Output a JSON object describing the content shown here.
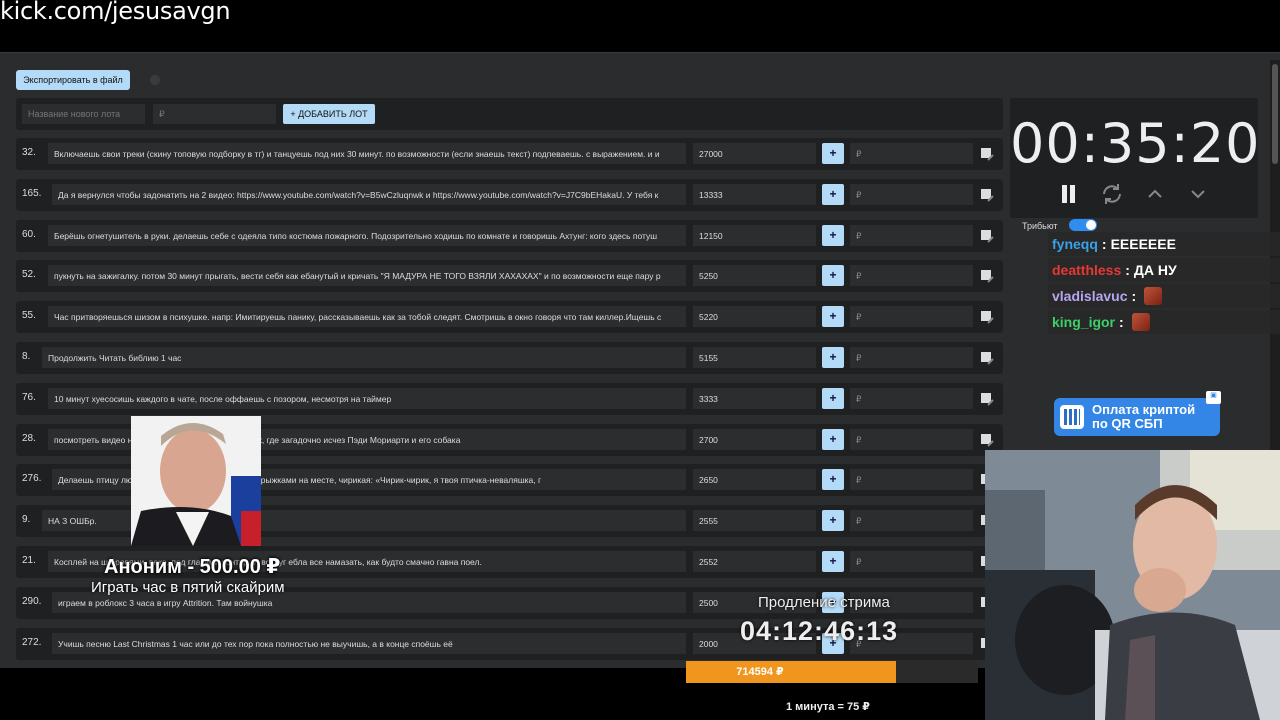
{
  "page": {
    "url": "kick.com/jesusavgn"
  },
  "toolbar": {
    "export_label": "Экспортировать в файл"
  },
  "add_lot": {
    "name_placeholder": "Название нового лота",
    "price_placeholder": "₽",
    "button_label": "+ ДОБАВИТЬ ЛОТ"
  },
  "lots": [
    {
      "num": "32.",
      "title": "Включаешь свои треки (скину топовую подборку в тг) и танцуешь под них 30 минут. по возможности (если знаешь текст) подпеваешь. с выражением. и и",
      "amount": "27000",
      "add_placeholder": "₽"
    },
    {
      "num": "165.",
      "title": "Да я вернулся чтобы задонатить на 2 видео: https://www.youtube.com/watch?v=B5wCzluqnwk и https://www.youtube.com/watch?v=J7C9bEHakaU. У тебя к",
      "amount": "13333",
      "add_placeholder": "₽"
    },
    {
      "num": "60.",
      "title": "Берёшь огнетушитель в руки. делаешь себе с одеяла типо костюма пожарного. Подозрительно ходишь по комнате и говоришь Ахтунг: кого здесь потуш",
      "amount": "12150",
      "add_placeholder": "₽"
    },
    {
      "num": "52.",
      "title": "пукнуть на зажигалку. потом 30 минут прыгать, вести себя как ебанутый и кричать \"Я МАДУРА НЕ ТОГО ВЗЯЛИ ХАХАХАХ\" и по возможности еще пару р",
      "amount": "5250",
      "add_placeholder": "₽"
    },
    {
      "num": "55.",
      "title": "Час притворяешься шизом в психушке. напр: Имитируешь панику, рассказываешь как за тобой следят. Смотришь в окно говоря что там киллер.Ищешь с",
      "amount": "5220",
      "add_placeholder": "₽"
    },
    {
      "num": "8.",
      "title": "Продолжить Читать библию 1 час",
      "amount": "5155",
      "add_placeholder": "₽"
    },
    {
      "num": "76.",
      "title": "10 минут хуесосишь каждого в чате, после оффаешь с позором, несмотря на таймер",
      "amount": "3333",
      "add_placeholder": "₽"
    },
    {
      "num": "28.",
      "title": "посмотреть видео на                                              ии с населением из 11 человек, где загадочно исчез Пэди Мориарти и его собака",
      "amount": "2700",
      "add_placeholder": "₽"
    },
    {
      "num": "276.",
      "title": "Делаешь птицу лю                                           после летаешь вокруг камеры прыжками на месте, чирикая: «Чирик-чирик, я твоя птичка-неваляшка, г",
      "amount": "2650",
      "add_placeholder": "₽"
    },
    {
      "num": "9.",
      "title": "НА З ОШБр.",
      "amount": "2555",
      "add_placeholder": "₽"
    },
    {
      "num": "21.",
      "title": "Косплей на ш                                          бровями, веко, под глазами контур. И вокруг ебла все намазать, как будто смачно гавна поел.",
      "amount": "2552",
      "add_placeholder": "₽"
    },
    {
      "num": "290.",
      "title": "играем в роблокс 3 часа в игру Attrition. Там войнушка",
      "amount": "2500",
      "add_placeholder": "₽"
    },
    {
      "num": "272.",
      "title": "Учишь песню Last Christmas 1 час или до тех пор пока полностью не выучишь, а в конце споёшь её",
      "amount": "2000",
      "add_placeholder": "₽"
    }
  ],
  "timer": {
    "display": "00:35:20"
  },
  "tribute": {
    "label": "Трибьют"
  },
  "chat": [
    {
      "user": "fyneqq",
      "sep": ":",
      "message": "ЕЕЕЕЕЕЕ",
      "color": "#3aa0e8",
      "emote": false
    },
    {
      "user": "deatthless",
      "sep": ":",
      "message": "ДА НУ",
      "color": "#e53935",
      "emote": false
    },
    {
      "user": "vladislavuc",
      "sep": ":",
      "message": "",
      "color": "#b7a6f0",
      "emote": true
    },
    {
      "user": "king_igor",
      "sep": ":",
      "message": "",
      "color": "#3ccf6a",
      "emote": true
    }
  ],
  "qr_banner": {
    "line1": "Оплата криптой",
    "line2": "по QR СБП"
  },
  "donation": {
    "name": "Аноним - 500.00 ₽",
    "message": "Играть час в пятий скайрим"
  },
  "extension": {
    "label": "Продление стрима",
    "timer": "04:12:46:13",
    "total": "714594 ₽",
    "progress_fraction": 0.72,
    "rate": "1 минута = 75 ₽"
  },
  "colors": {
    "accent": "#b3dbf7",
    "progress": "#f0961e",
    "panel": "#1f2022",
    "bg": "#2b2c2e"
  }
}
